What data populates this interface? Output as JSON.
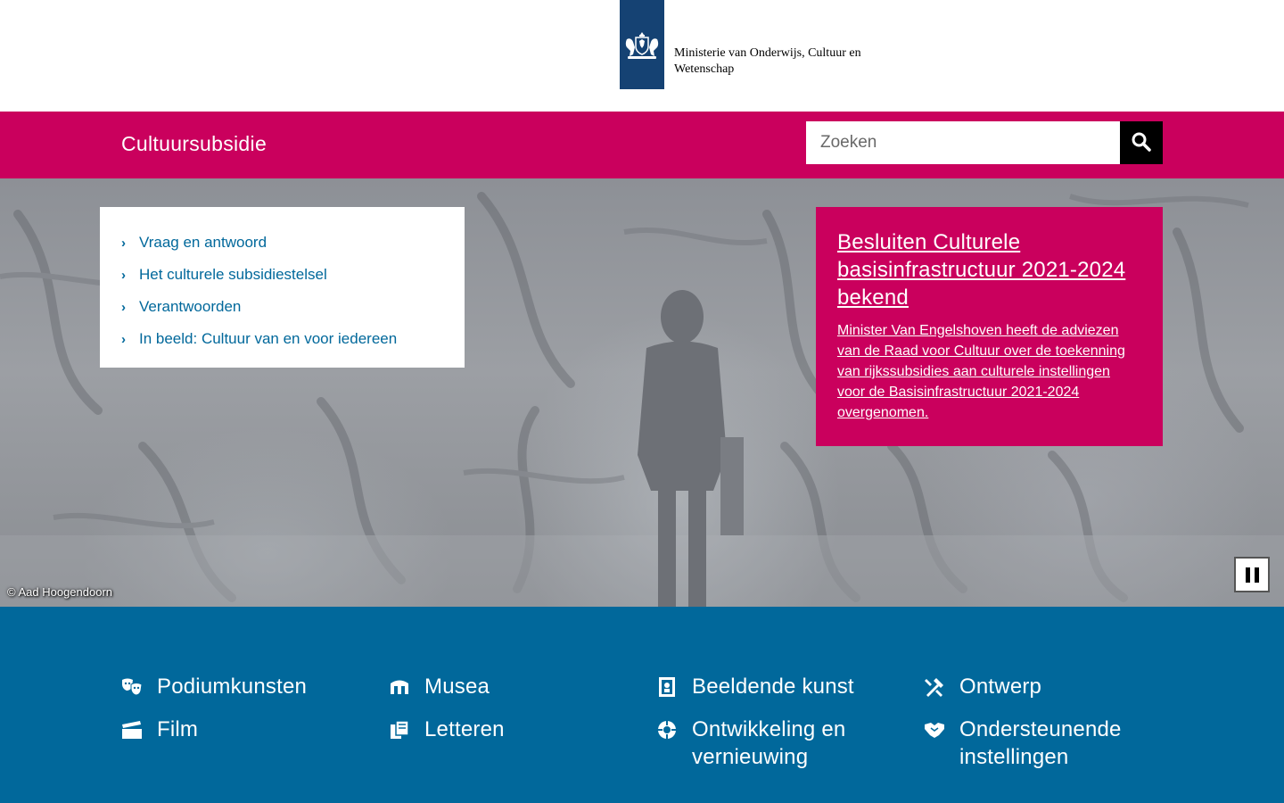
{
  "header": {
    "logo_line1": "Ministerie van Onderwijs, Cultuur en",
    "logo_line2": "Wetenschap"
  },
  "site_bar": {
    "title": "Cultuursubsidie",
    "search_placeholder": "Zoeken"
  },
  "hero": {
    "links": [
      {
        "label": "Vraag en antwoord"
      },
      {
        "label": "Het culturele subsidiestelsel"
      },
      {
        "label": "Verantwoorden"
      },
      {
        "label": "In beeld: Cultuur van en voor iedereen"
      }
    ],
    "news": {
      "title": "Besluiten Culturele basisinfrastructuur 2021-2024 bekend",
      "body": "Minister Van Engelshoven heeft de adviezen van de Raad voor Cultuur over de toekenning van rijkssubsidies aan culturele instellingen voor de Basisinfrastructuur 2021-2024 overgenomen."
    },
    "credit": "© Aad Hoogendoorn"
  },
  "categories": [
    {
      "label": "Podiumkunsten",
      "icon": "theater-masks-icon"
    },
    {
      "label": "Musea",
      "icon": "museum-icon"
    },
    {
      "label": "Beeldende kunst",
      "icon": "artwork-icon"
    },
    {
      "label": "Ontwerp",
      "icon": "design-tools-icon"
    },
    {
      "label": "Film",
      "icon": "clapperboard-icon"
    },
    {
      "label": "Letteren",
      "icon": "books-icon"
    },
    {
      "label": "Ontwikkeling en vernieuwing",
      "icon": "innovation-icon"
    },
    {
      "label": "Ondersteunende instellingen",
      "icon": "handshake-icon"
    }
  ],
  "colors": {
    "brand_pink": "#ca005d",
    "link_blue": "#01689b",
    "logo_blue": "#154273"
  }
}
